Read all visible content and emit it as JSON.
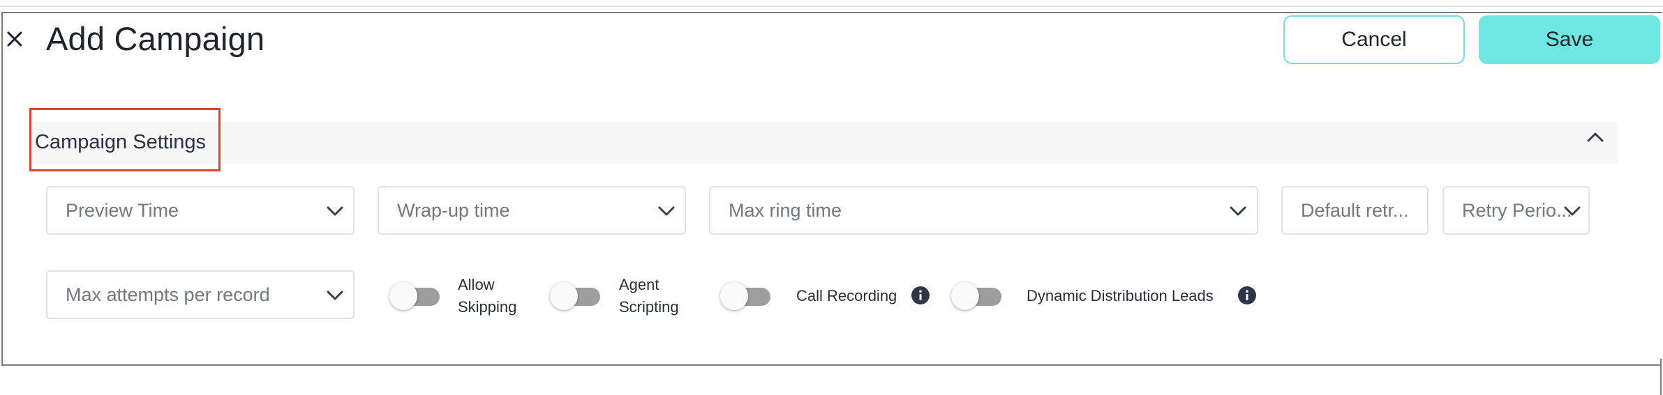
{
  "header": {
    "title": "Add Campaign",
    "cancel_label": "Cancel",
    "save_label": "Save"
  },
  "section": {
    "title": "Campaign Settings",
    "expanded": true
  },
  "fields": {
    "preview_time": "Preview Time",
    "wrap_up_time": "Wrap-up time",
    "max_ring_time": "Max ring time",
    "default_retry": "Default retr...",
    "retry_period": "Retry Perio...",
    "max_attempts": "Max attempts per record"
  },
  "toggles": {
    "allow_skipping": {
      "line1": "Allow",
      "line2": "Skipping",
      "on": false
    },
    "agent_scripting": {
      "line1": "Agent",
      "line2": "Scripting",
      "on": false
    },
    "call_recording": {
      "label": "Call Recording",
      "on": false
    },
    "dynamic_distribution": {
      "label": "Dynamic Distribution Leads",
      "on": false
    }
  },
  "icons": {
    "close": "close-icon",
    "section_toggle": "chevron-up-icon",
    "dropdown": "chevron-down-icon",
    "info": "info-icon"
  },
  "colors": {
    "accent": "#6ee7e2",
    "cancel_border": "#6fe0de",
    "highlight": "#e0442c",
    "toggle_off": "#9e9e9e",
    "info_icon": "#2d3648"
  }
}
